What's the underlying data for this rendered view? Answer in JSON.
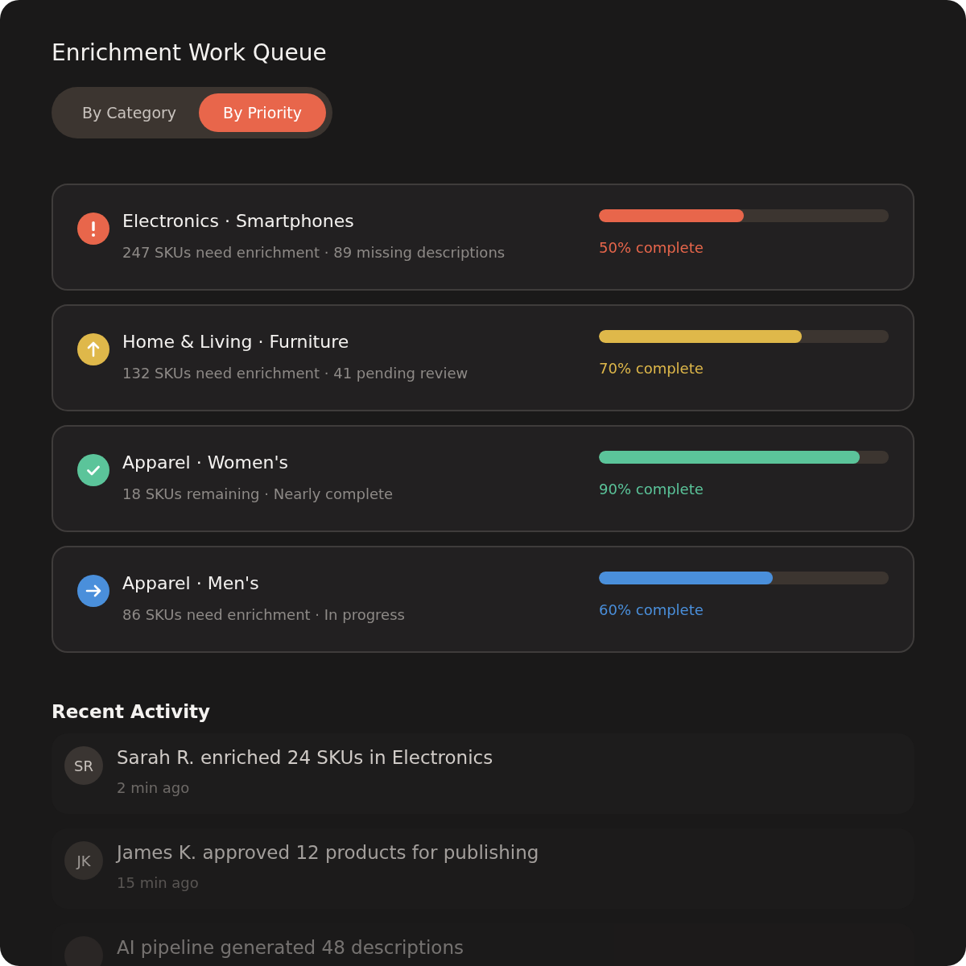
{
  "title": "Enrichment Work Queue",
  "tabs": [
    {
      "label": "By Category",
      "selected": false
    },
    {
      "label": "By Priority",
      "selected": true
    }
  ],
  "queue": [
    {
      "kind": "alert",
      "color": "#e8664b",
      "title": "Electronics · Smartphones",
      "detail": "247 SKUs need enrichment · 89 missing descriptions",
      "level": 0.5,
      "reading": "50% complete"
    },
    {
      "kind": "up",
      "color": "#dfb84a",
      "title": "Home & Living · Furniture",
      "detail": "132 SKUs need enrichment · 41 pending review",
      "level": 0.7,
      "reading": "70% complete"
    },
    {
      "kind": "check",
      "color": "#5bc49a",
      "title": "Apparel · Women's",
      "detail": "18 SKUs remaining · Nearly complete",
      "level": 0.9,
      "reading": "90% complete"
    },
    {
      "kind": "arrow",
      "color": "#4a8fdb",
      "title": "Apparel · Men's",
      "detail": "86 SKUs need enrichment · In progress",
      "level": 0.6,
      "reading": "60% complete"
    }
  ],
  "activity_title": "Recent Activity",
  "activity": [
    {
      "initials": "SR",
      "text": "Sarah R. enriched 24 SKUs in Electronics",
      "time": "2 min ago"
    },
    {
      "initials": "JK",
      "text": "James K. approved 12 products for publishing",
      "time": "15 min ago"
    },
    {
      "text": "AI pipeline generated 48 descriptions"
    }
  ]
}
